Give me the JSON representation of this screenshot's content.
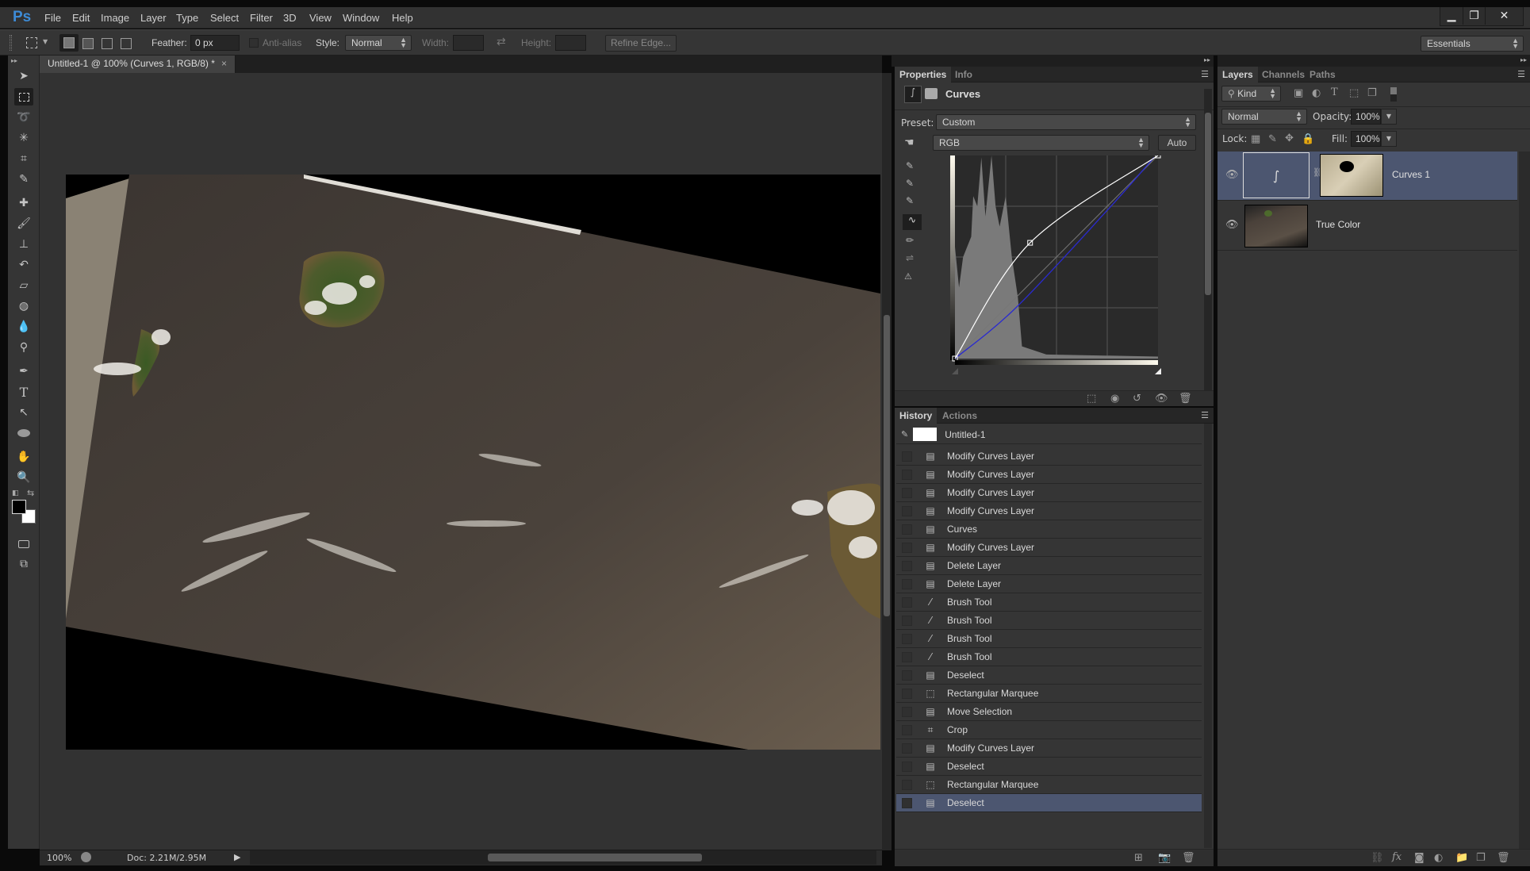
{
  "app": {
    "logo": "Ps",
    "title": "Untitled-1 @ 100% (Curves 1, RGB/8) *"
  },
  "menu": [
    "File",
    "Edit",
    "Image",
    "Layer",
    "Type",
    "Select",
    "Filter",
    "3D",
    "View",
    "Window",
    "Help"
  ],
  "window_controls": {
    "minimize": "▁",
    "restore": "❐",
    "close": "✕"
  },
  "options": {
    "feather_label": "Feather:",
    "feather_value": "0 px",
    "antialias_label": "Anti-alias",
    "style_label": "Style:",
    "style_value": "Normal",
    "width_label": "Width:",
    "height_label": "Height:",
    "refine_edge": "Refine Edge...",
    "workspace": "Essentials"
  },
  "document": {
    "tab_title": "Untitled-1 @ 100% (Curves 1, RGB/8) *",
    "tab_close": "×"
  },
  "status": {
    "zoom": "100%",
    "doc_size": "Doc: 2.21M/2.95M"
  },
  "tools": [
    "move-tool",
    "rectangular-marquee-tool",
    "lasso-tool",
    "magic-wand-tool",
    "crop-tool",
    "eyedropper-tool",
    "spot-healing-tool",
    "brush-tool",
    "clone-stamp-tool",
    "history-brush-tool",
    "eraser-tool",
    "paint-bucket-tool",
    "blur-tool",
    "dodge-tool",
    "pen-tool",
    "type-tool",
    "path-selection-tool",
    "ellipse-tool",
    "hand-tool",
    "zoom-tool"
  ],
  "colors": {
    "foreground": "#000000",
    "background": "#ffffff",
    "selection": "#4c5670",
    "accent": "#3d8bd6",
    "curve_rgb": "#ffffff",
    "curve_blue": "#2a2ad0"
  },
  "properties": {
    "tabs": [
      "Properties",
      "Info"
    ],
    "active_tab": "Properties",
    "adjustment": "Curves",
    "preset_label": "Preset:",
    "preset_value": "Custom",
    "channel_value": "RGB",
    "auto_button": "Auto",
    "curve_points_rgb": [
      [
        0,
        0
      ],
      [
        0.37,
        0.57
      ],
      [
        1,
        1
      ]
    ],
    "blue_curve_note": "near-linear, slightly below diagonal"
  },
  "history": {
    "tabs": [
      "History",
      "Actions"
    ],
    "active_tab": "History",
    "snapshot": "Untitled-1",
    "items": [
      {
        "label": "Modify Curves Layer",
        "icon": "document-icon"
      },
      {
        "label": "Modify Curves Layer",
        "icon": "document-icon"
      },
      {
        "label": "Modify Curves Layer",
        "icon": "document-icon"
      },
      {
        "label": "Modify Curves Layer",
        "icon": "document-icon"
      },
      {
        "label": "Curves",
        "icon": "document-icon"
      },
      {
        "label": "Modify Curves Layer",
        "icon": "document-icon"
      },
      {
        "label": "Delete Layer",
        "icon": "document-icon"
      },
      {
        "label": "Delete Layer",
        "icon": "document-icon"
      },
      {
        "label": "Brush Tool",
        "icon": "brush-icon"
      },
      {
        "label": "Brush Tool",
        "icon": "brush-icon"
      },
      {
        "label": "Brush Tool",
        "icon": "brush-icon"
      },
      {
        "label": "Brush Tool",
        "icon": "brush-icon"
      },
      {
        "label": "Deselect",
        "icon": "document-icon"
      },
      {
        "label": "Rectangular Marquee",
        "icon": "marquee-icon"
      },
      {
        "label": "Move Selection",
        "icon": "document-icon"
      },
      {
        "label": "Crop",
        "icon": "crop-icon"
      },
      {
        "label": "Modify Curves Layer",
        "icon": "document-icon"
      },
      {
        "label": "Deselect",
        "icon": "document-icon"
      },
      {
        "label": "Rectangular Marquee",
        "icon": "marquee-icon"
      },
      {
        "label": "Deselect",
        "icon": "document-icon"
      }
    ],
    "selected_index": 19
  },
  "layers": {
    "tabs": [
      "Layers",
      "Channels",
      "Paths"
    ],
    "active_tab": "Layers",
    "filter": "Kind",
    "blend_mode": "Normal",
    "opacity_label": "Opacity:",
    "opacity": "100%",
    "lock_label": "Lock:",
    "fill_label": "Fill:",
    "fill": "100%",
    "items": [
      {
        "name": "Curves 1",
        "selected": true,
        "visible": true
      },
      {
        "name": "True Color",
        "selected": false,
        "visible": true
      }
    ]
  }
}
